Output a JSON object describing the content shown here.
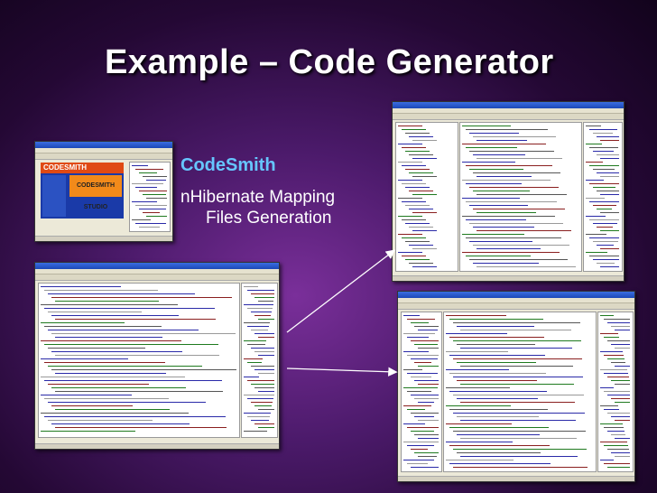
{
  "slide": {
    "title": "Example – Code Generator",
    "bullet_primary": "CodeSmith",
    "bullet_secondary_line1": "nHibernate Mapping",
    "bullet_secondary_line2": "Files Generation"
  },
  "splash_logo_text": "CODESMITH",
  "splash_studio_text": "CODESMITH STUDIO",
  "colors": {
    "title": "#ffffff",
    "accent_bullet": "#66c6ff",
    "background_center": "#7a2f9a",
    "background_edge": "#12031c"
  }
}
